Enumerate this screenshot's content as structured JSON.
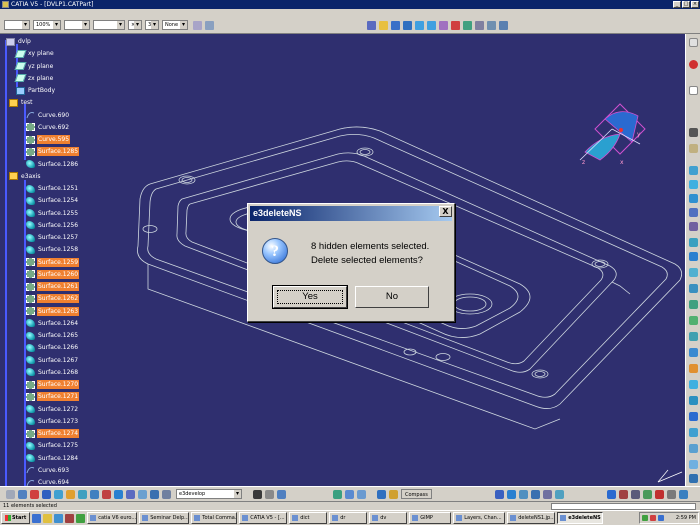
{
  "window": {
    "title": "CATIA V5 - [DVLP1.CATPart]"
  },
  "toolbar": {
    "zoom_value": "100%",
    "layer_value": "None",
    "count_value": "3"
  },
  "tree": {
    "items": [
      {
        "label": "dvlp",
        "icon": "part-root-icon",
        "selected": false
      },
      {
        "label": "xy plane",
        "icon": "plane-icon",
        "selected": false
      },
      {
        "label": "yz plane",
        "icon": "plane-icon",
        "selected": false
      },
      {
        "label": "zx plane",
        "icon": "plane-icon",
        "selected": false
      },
      {
        "label": "PartBody",
        "icon": "body-icon",
        "selected": false
      },
      {
        "label": "test",
        "icon": "geometrical-set-icon",
        "selected": false
      },
      {
        "label": "Curve.690",
        "icon": "curve-icon",
        "selected": false
      },
      {
        "label": "Curve.692",
        "icon": "hidden-curve-icon",
        "selected": false
      },
      {
        "label": "Curve.595",
        "icon": "hidden-curve-icon",
        "selected": true
      },
      {
        "label": "Surface.1285",
        "icon": "hidden-surface-icon",
        "selected": true
      },
      {
        "label": "Surface.1286",
        "icon": "surface-icon",
        "selected": false
      },
      {
        "label": "e3axis",
        "icon": "geometrical-set-icon",
        "selected": false
      },
      {
        "label": "Surface.1251",
        "icon": "surface-icon",
        "selected": false
      },
      {
        "label": "Surface.1254",
        "icon": "surface-icon",
        "selected": false
      },
      {
        "label": "Surface.1255",
        "icon": "surface-icon",
        "selected": false
      },
      {
        "label": "Surface.1256",
        "icon": "surface-icon",
        "selected": false
      },
      {
        "label": "Surface.1257",
        "icon": "surface-icon",
        "selected": false
      },
      {
        "label": "Surface.1258",
        "icon": "surface-icon",
        "selected": false
      },
      {
        "label": "Surface.1259",
        "icon": "hidden-surface-icon",
        "selected": true
      },
      {
        "label": "Surface.1260",
        "icon": "hidden-surface-icon",
        "selected": true
      },
      {
        "label": "Surface.1261",
        "icon": "hidden-surface-icon",
        "selected": true
      },
      {
        "label": "Surface.1262",
        "icon": "hidden-surface-icon",
        "selected": true
      },
      {
        "label": "Surface.1263",
        "icon": "hidden-surface-icon",
        "selected": true
      },
      {
        "label": "Surface.1264",
        "icon": "surface-icon",
        "selected": false
      },
      {
        "label": "Surface.1265",
        "icon": "surface-icon",
        "selected": false
      },
      {
        "label": "Surface.1266",
        "icon": "surface-icon",
        "selected": false
      },
      {
        "label": "Surface.1267",
        "icon": "surface-icon",
        "selected": false
      },
      {
        "label": "Surface.1268",
        "icon": "surface-icon",
        "selected": false
      },
      {
        "label": "Surface.1270",
        "icon": "hidden-surface-icon",
        "selected": true
      },
      {
        "label": "Surface.1271",
        "icon": "hidden-surface-icon",
        "selected": true
      },
      {
        "label": "Surface.1272",
        "icon": "surface-icon",
        "selected": false
      },
      {
        "label": "Surface.1273",
        "icon": "surface-icon",
        "selected": false
      },
      {
        "label": "Surface.1274",
        "icon": "hidden-surface-icon",
        "selected": true
      },
      {
        "label": "Surface.1275",
        "icon": "surface-icon",
        "selected": false
      },
      {
        "label": "Surface.1284",
        "icon": "surface-icon",
        "selected": false
      },
      {
        "label": "Curve.693",
        "icon": "curve-icon",
        "selected": false
      },
      {
        "label": "Curve.694",
        "icon": "curve-icon",
        "selected": false
      }
    ]
  },
  "dialog": {
    "title": "e3deleteNS",
    "close_label": "X",
    "icon": "question-icon",
    "icon_glyph": "?",
    "message_line1": "8 hidden elements selected.",
    "message_line2": "Delete selected elements?",
    "yes_label": "Yes",
    "no_label": "No"
  },
  "bottom_toolbar": {
    "combo_value": "e3develop",
    "compass_label": "Compass"
  },
  "status": {
    "text": "11 elements selected"
  },
  "taskbar": {
    "start_label": "Start",
    "tasks": [
      {
        "label": "catia V6 euro...",
        "active": false
      },
      {
        "label": "Seminar Delp...",
        "active": false
      },
      {
        "label": "Total Comma...",
        "active": false
      },
      {
        "label": "CATIA V5 - [...",
        "active": false
      },
      {
        "label": "dict",
        "active": false
      },
      {
        "label": "dr",
        "active": false
      },
      {
        "label": "dv",
        "active": false
      },
      {
        "label": "GIMP",
        "active": false
      },
      {
        "label": "Layers, Chan...",
        "active": false
      },
      {
        "label": "deleteNS1.jp...",
        "active": false
      },
      {
        "label": "e3deleteNS",
        "active": true
      }
    ],
    "clock": "2:59 PM"
  },
  "colors": {
    "viewport_bg": "#2f2f6f",
    "selection": "#f08030",
    "dialog_bg": "#d4d0c8",
    "title_bar": "#0a246a"
  }
}
